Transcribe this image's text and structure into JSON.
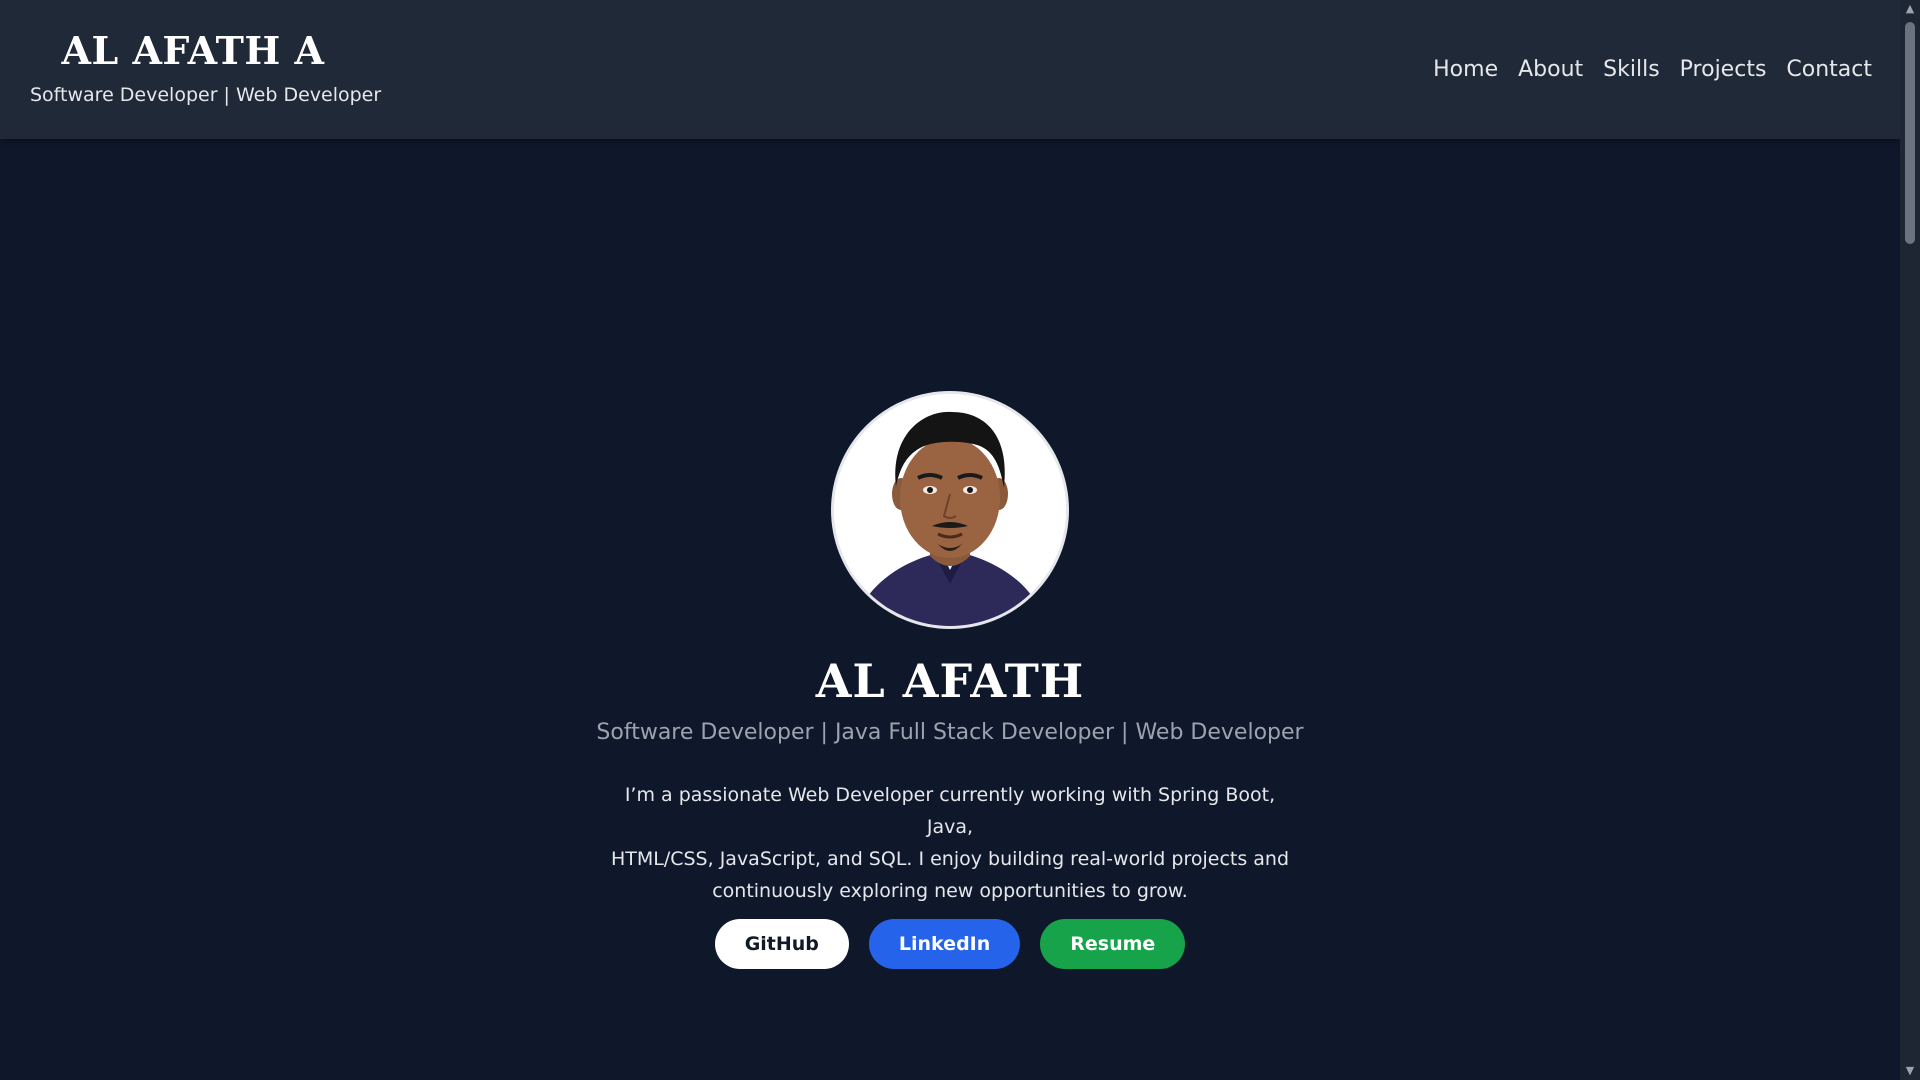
{
  "header": {
    "brand_name": "AL AFATH A",
    "brand_tagline": "Software Developer | Web Developer",
    "nav": [
      "Home",
      "About",
      "Skills",
      "Projects",
      "Contact"
    ]
  },
  "hero": {
    "avatar_icon": "profile-photo",
    "name": "AL AFATH",
    "subtitle": "Software Developer | Java Full Stack Developer | Web Developer",
    "bio_lines": [
      "I’m a passionate Web Developer currently working with Spring Boot, Java,",
      "HTML/CSS, JavaScript, and SQL. I enjoy building real-world projects and",
      "continuously exploring new opportunities to grow."
    ],
    "buttons": {
      "github": "GitHub",
      "linkedin": "LinkedIn",
      "resume": "Resume"
    }
  },
  "colors": {
    "background": "#0f172a",
    "header": "#1f2937",
    "github_button": "#ffffff",
    "linkedin_button": "#2563eb",
    "resume_button": "#16a34a"
  }
}
